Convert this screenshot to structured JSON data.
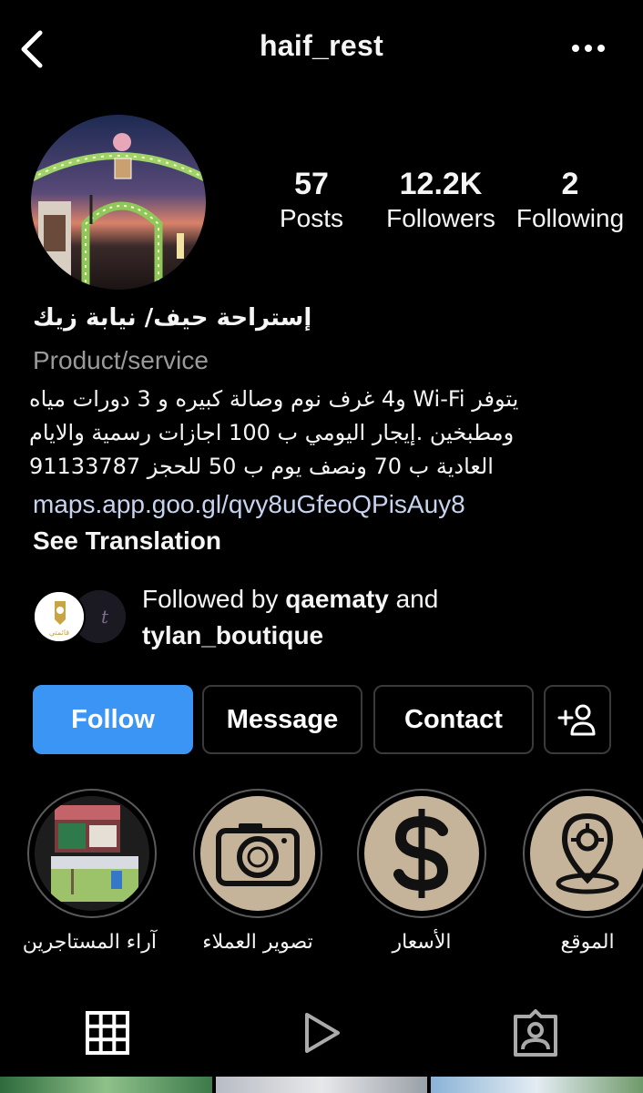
{
  "header": {
    "username": "haif_rest",
    "back_icon": "chevron-left-icon",
    "more_icon": "more-horizontal-icon"
  },
  "profile": {
    "stats": {
      "posts_count": "57",
      "posts_label": "Posts",
      "followers_count": "12.2K",
      "followers_label": "Followers",
      "following_count": "2",
      "following_label": "Following"
    },
    "name": "إستراحة حيف/ نيابة زيك",
    "category": "Product/service",
    "bio_lines": [
      "يتوفر Wi-Fi و4 غرف نوم وصالة كبيره و 3 دورات مياه",
      "ومطبخين .إيجار اليومي ب 100 اجازات رسمية والايام",
      "العادية ب 70 ونصف يوم ب 50 للحجز 91133787"
    ],
    "link": "maps.app.goo.gl/qvy8uGfeoQPisAuy8",
    "see_translation": "See Translation",
    "followed_by": {
      "prefix": "Followed by",
      "user1": "qaematy",
      "and": "and",
      "user2": "tylan_boutique",
      "avatar1_text": "قائمتي"
    }
  },
  "actions": {
    "follow": "Follow",
    "message": "Message",
    "contact": "Contact",
    "add_user_icon": "add-user-icon"
  },
  "highlights": [
    {
      "label": "آراء المستاجرين",
      "icon": "photo-collage"
    },
    {
      "label": "تصوير العملاء",
      "icon": "camera-icon"
    },
    {
      "label": "الأسعار",
      "icon": "dollar-icon"
    },
    {
      "label": "الموقع",
      "icon": "location-pin-icon"
    }
  ],
  "tabs": [
    {
      "name": "grid-icon"
    },
    {
      "name": "reels-play-icon"
    },
    {
      "name": "tagged-person-icon"
    }
  ],
  "colors": {
    "background": "#000000",
    "follow_button": "#3b95f5",
    "link": "#c7d3ef",
    "category_text": "#9a9a9a",
    "highlight_fill": "#c6b49a"
  }
}
